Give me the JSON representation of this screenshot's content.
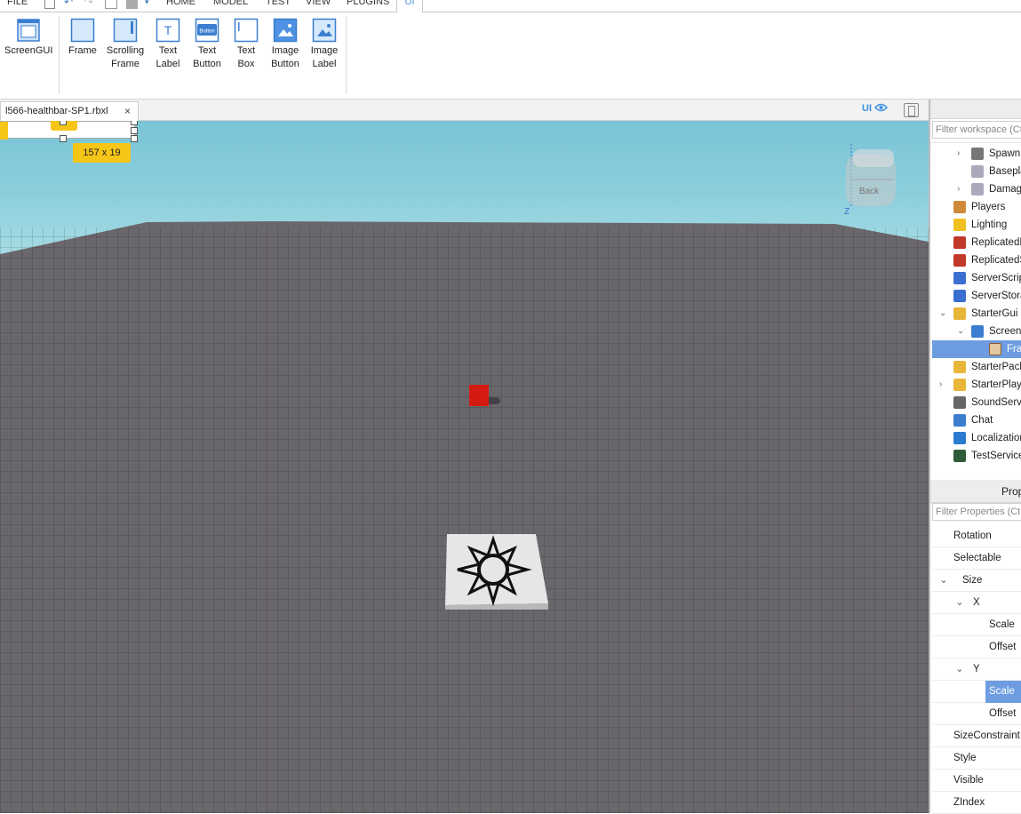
{
  "menu": {
    "items": [
      "FILE",
      "HOME",
      "MODEL",
      "TEST",
      "VIEW",
      "PLUGINS"
    ],
    "active_tab": "UI"
  },
  "ribbon": {
    "screengui": "ScreenGUI",
    "buttons": [
      {
        "line1": "Frame",
        "line2": ""
      },
      {
        "line1": "Scrolling",
        "line2": "Frame"
      },
      {
        "line1": "Text",
        "line2": "Label"
      },
      {
        "line1": "Text",
        "line2": "Button"
      },
      {
        "line1": "Text",
        "line2": "Box"
      },
      {
        "line1": "Image",
        "line2": "Button"
      },
      {
        "line1": "Image",
        "line2": "Label"
      }
    ],
    "button_icon_text": "Button",
    "textlabel_icon_text": "T"
  },
  "doc_tab": {
    "title": "l566-healthbar-SP1.rbxl",
    "close": "×"
  },
  "viewport": {
    "ui_toggle": "UI",
    "size_badge": "157 x 19",
    "viewcube_label": "Back",
    "axis_label": "Z"
  },
  "explorer": {
    "filter_placeholder": "Filter workspace (Ctrl+Shift+X)",
    "items": [
      {
        "label": "SpawnLocation",
        "icon": "spawn-icon",
        "chev": "›"
      },
      {
        "label": "Baseplate",
        "icon": "part-icon",
        "chev": ""
      },
      {
        "label": "DamagePart",
        "icon": "part-icon",
        "chev": "›"
      },
      {
        "label": "Players",
        "icon": "players-icon",
        "chev": ""
      },
      {
        "label": "Lighting",
        "icon": "lighting-icon",
        "chev": ""
      },
      {
        "label": "ReplicatedFirst",
        "icon": "replicated-icon",
        "chev": ""
      },
      {
        "label": "ReplicatedStorage",
        "icon": "replicated-icon",
        "chev": ""
      },
      {
        "label": "ServerScriptService",
        "icon": "server-script-icon",
        "chev": ""
      },
      {
        "label": "ServerStorage",
        "icon": "server-storage-icon",
        "chev": ""
      },
      {
        "label": "StarterGui",
        "icon": "folder-icon",
        "chev": "⌄"
      },
      {
        "label": "ScreenGui",
        "icon": "screengui-icon",
        "chev": "⌄"
      },
      {
        "label": "Frame",
        "icon": "frame-icon",
        "chev": ""
      },
      {
        "label": "StarterPack",
        "icon": "folder-icon",
        "chev": ""
      },
      {
        "label": "StarterPlayer",
        "icon": "folder-icon",
        "chev": "›"
      },
      {
        "label": "SoundService",
        "icon": "sound-icon",
        "chev": ""
      },
      {
        "label": "Chat",
        "icon": "chat-icon",
        "chev": ""
      },
      {
        "label": "LocalizationService",
        "icon": "globe-icon",
        "chev": ""
      },
      {
        "label": "TestService",
        "icon": "check-icon",
        "chev": ""
      }
    ]
  },
  "properties": {
    "title": "Properties",
    "filter_placeholder": "Filter Properties (Ctrl+Shift+P)",
    "rows": [
      {
        "label": "Rotation",
        "chev": ""
      },
      {
        "label": "Selectable",
        "chev": ""
      },
      {
        "label": "Size",
        "chev": "⌄"
      },
      {
        "label": "X",
        "chev": "⌄"
      },
      {
        "label": "Scale",
        "chev": ""
      },
      {
        "label": "Offset",
        "chev": ""
      },
      {
        "label": "Y",
        "chev": "⌄"
      },
      {
        "label": "Scale",
        "chev": ""
      },
      {
        "label": "Offset",
        "chev": ""
      },
      {
        "label": "SizeConstraint",
        "chev": ""
      },
      {
        "label": "Style",
        "chev": ""
      },
      {
        "label": "Visible",
        "chev": ""
      },
      {
        "label": "ZIndex",
        "chev": ""
      }
    ]
  },
  "colors": {
    "accent": "#3b8fe0",
    "selection": "#6d9de0",
    "highlight_yellow": "#f5c518",
    "cube_red": "#d41b12"
  }
}
